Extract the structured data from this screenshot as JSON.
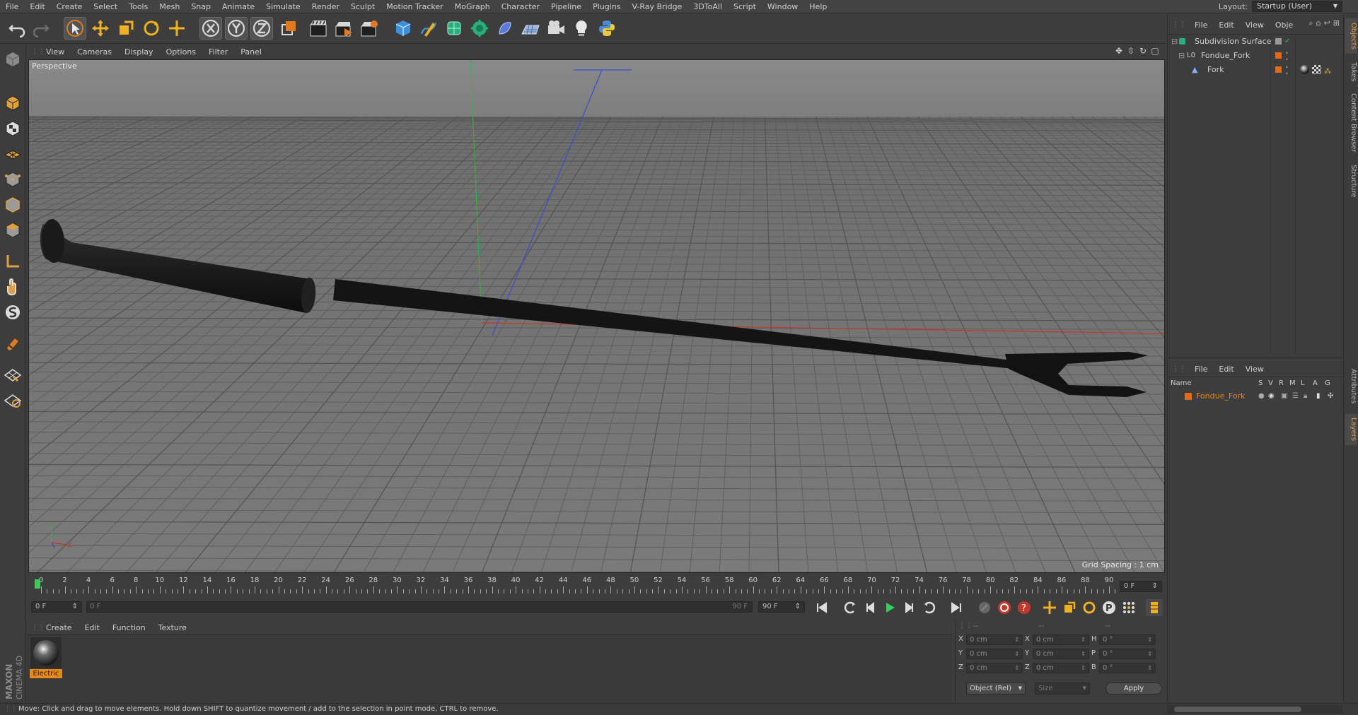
{
  "menubar": {
    "items": [
      "File",
      "Edit",
      "Create",
      "Select",
      "Tools",
      "Mesh",
      "Snap",
      "Animate",
      "Simulate",
      "Render",
      "Sculpt",
      "Motion Tracker",
      "MoGraph",
      "Character",
      "Pipeline",
      "Plugins",
      "V-Ray Bridge",
      "3DToAll",
      "Script",
      "Window",
      "Help"
    ],
    "layout_label": "Layout:",
    "layout_value": "Startup (User)"
  },
  "viewport": {
    "menu": [
      "View",
      "Cameras",
      "Display",
      "Options",
      "Filter",
      "Panel"
    ],
    "label": "Perspective",
    "grid_spacing": "Grid Spacing : 1 cm",
    "axis_y": "Y",
    "axis_x": "X"
  },
  "timeline": {
    "ticks": [
      "0",
      "2",
      "4",
      "6",
      "8",
      "10",
      "12",
      "14",
      "16",
      "18",
      "20",
      "22",
      "24",
      "26",
      "28",
      "30",
      "32",
      "34",
      "36",
      "38",
      "40",
      "42",
      "44",
      "46",
      "48",
      "50",
      "52",
      "54",
      "56",
      "58",
      "60",
      "62",
      "64",
      "66",
      "68",
      "70",
      "72",
      "74",
      "76",
      "78",
      "80",
      "82",
      "84",
      "86",
      "88",
      "90"
    ],
    "current_frame": "0 F",
    "start_field": "0 F",
    "range_start": "0 F",
    "range_end": "90 F",
    "end_field": "90 F"
  },
  "material_manager": {
    "menu": [
      "Create",
      "Edit",
      "Function",
      "Texture"
    ],
    "materials": [
      {
        "name": "Electric"
      }
    ]
  },
  "coordinates": {
    "header": [
      "--",
      "--",
      "--"
    ],
    "rows": [
      {
        "a": "X",
        "a_val": "0 cm",
        "b": "X",
        "b_val": "0 cm",
        "c": "H",
        "c_val": "0 °"
      },
      {
        "a": "Y",
        "a_val": "0 cm",
        "b": "Y",
        "b_val": "0 cm",
        "c": "P",
        "c_val": "0 °"
      },
      {
        "a": "Z",
        "a_val": "0 cm",
        "b": "Z",
        "b_val": "0 cm",
        "c": "B",
        "c_val": "0 °"
      }
    ],
    "mode": "Object (Rel)",
    "size": "Size",
    "apply": "Apply"
  },
  "object_manager": {
    "menu": [
      "File",
      "Edit",
      "View",
      "Obje"
    ],
    "objects": [
      {
        "name": "Subdivision Surface",
        "depth": 0
      },
      {
        "name": "Fondue_Fork",
        "depth": 1
      },
      {
        "name": "Fork",
        "depth": 2
      }
    ]
  },
  "layer_manager": {
    "menu": [
      "File",
      "Edit",
      "View"
    ],
    "columns": [
      "Name",
      "S",
      "V",
      "R",
      "M",
      "L",
      "A",
      "G"
    ],
    "layers": [
      {
        "name": "Fondue_Fork",
        "color": "#e06a1a"
      }
    ]
  },
  "side_tabs": [
    "Objects",
    "Takes",
    "Content Browser",
    "Structure",
    "Attributes",
    "Layers"
  ],
  "status": "Move: Click and drag to move elements. Hold down SHIFT to quantize movement / add to the selection in point mode, CTRL to remove.",
  "logo": {
    "brand": "MAXON",
    "product": "CINEMA 4D"
  },
  "colors": {
    "accent": "#e88a1a",
    "x_axis": "#c0392b",
    "y_axis": "#3cb043",
    "z_axis": "#3a4bd6",
    "viewport_bg": "#737373"
  }
}
